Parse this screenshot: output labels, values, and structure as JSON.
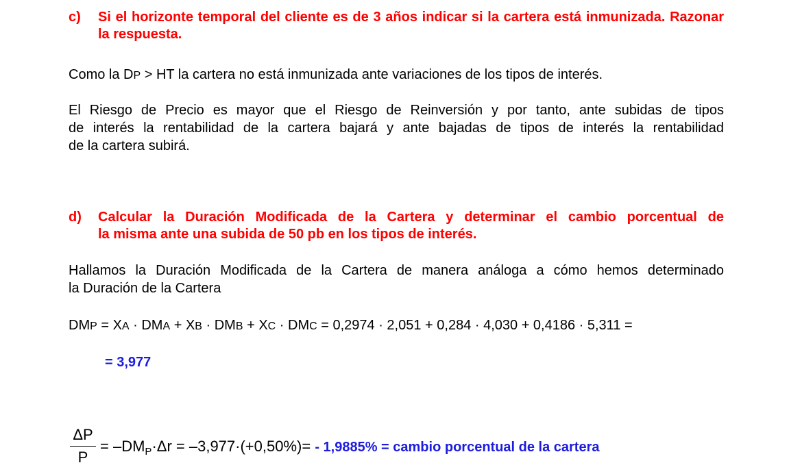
{
  "question_c": {
    "letter": "c)",
    "text": "Si el horizonte temporal del cliente es de 3 años indicar si la cartera está inmunizada. Razonar la respuesta."
  },
  "paragraph_1": {
    "pre": "Como la D",
    "sub": "P",
    "post": " > HT  la cartera no está inmunizada ante variaciones de los tipos de interés."
  },
  "paragraph_2": {
    "line1": "El Riesgo de Precio es mayor que el Riesgo de Reinversión y por tanto, ante subidas de tipos",
    "line2": "de interés la rentabilidad de la cartera bajará y ante bajadas de tipos de interés la rentabilidad",
    "line3": "de la cartera subirá."
  },
  "question_d": {
    "letter": "d)",
    "line1": "Calcular la Duración Modificada de la Cartera y determinar el cambio porcentual de",
    "line2": "la misma ante una subida de 50 pb en los tipos de interés."
  },
  "paragraph_3": {
    "line1": "Hallamos la Duración Modificada de la Cartera de manera análoga a cómo hemos determinado",
    "line2": "la Duración de la Cartera"
  },
  "equation_dm": {
    "t1": "DM",
    "s1": "P",
    "t2": " = X",
    "s2": "A",
    "t3": " · DM",
    "s3": "A",
    "t4": " + X",
    "s4": "B",
    "t5": " · DM",
    "s5": "B",
    "t6": " + X",
    "s6": "C",
    "t7": " · DM",
    "s7": "C",
    "t8": " = 0,2974 · 2,051 + 0,284 · 4,030 +  0,4186 · 5,311 ="
  },
  "result_dm": "= 3,977",
  "formula": {
    "numerator": "ΔP",
    "denominator": "P",
    "t1": "= –DM",
    "s1": "P",
    "t2": "·Δr = –3,977·(+0,50%)= ",
    "answer": "- 1,9885% = cambio porcentual de la cartera"
  },
  "colors": {
    "question": "#ff0000",
    "result": "#1c1ce0",
    "text": "#000000"
  }
}
